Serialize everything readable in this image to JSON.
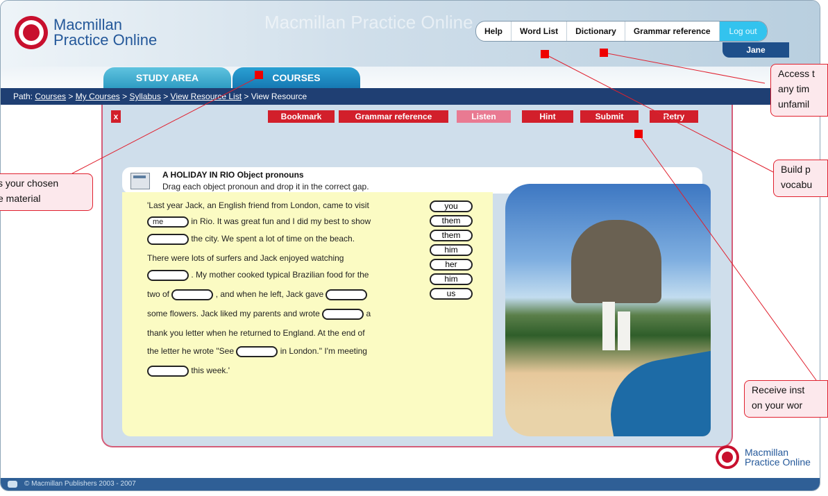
{
  "app": {
    "logo_line1": "Macmillan",
    "logo_line2": "Practice Online",
    "watermark": "Macmillan Practice Online"
  },
  "topnav": {
    "help": "Help",
    "word_list": "Word List",
    "dictionary": "Dictionary",
    "grammar_reference": "Grammar reference",
    "logout": "Log out",
    "username": "Jane"
  },
  "tabs": {
    "study_area": "STUDY AREA",
    "courses": "COURSES"
  },
  "path": {
    "label": "Path:",
    "crumbs": [
      "Courses",
      "My Courses",
      "Syllabus",
      "View Resource List"
    ],
    "current": "View Resource",
    "separator": ">"
  },
  "toolbar": {
    "close": "x",
    "bookmark": "Bookmark",
    "grammar_reference": "Grammar reference",
    "listen": "Listen",
    "hint": "Hint",
    "submit": "Submit",
    "retry": "Retry"
  },
  "exercise": {
    "title": "A HOLIDAY IN RIO   Object pronouns",
    "instruction": "Drag each object pronoun and drop it in the correct gap.",
    "lines": [
      "'Last year Jack, an English friend from London, came to visit",
      "in Rio. It was great fun and I did my best to show",
      "the city. We spent a lot of time on the beach.",
      "There were lots of surfers and Jack enjoyed watching",
      ". My mother cooked typical Brazilian food for the",
      "two of",
      ", and when he left, Jack gave",
      "some flowers. Jack liked my parents and wrote",
      "a",
      "thank you letter when he returned to England. At the end of",
      "the letter he wrote \"See",
      "in London.\" I'm meeting",
      "this week.'"
    ],
    "filled_gap": "me",
    "pronouns": [
      "you",
      "them",
      "them",
      "him",
      "her",
      "him",
      "us"
    ]
  },
  "callouts": {
    "access_tools": [
      "Access t",
      "any tim",
      "unfamil"
    ],
    "chosen_material": [
      "s your chosen",
      "e material"
    ],
    "build_vocab": [
      "Build p",
      "vocabu"
    ],
    "instant_feedback": [
      "Receive inst",
      "on your wor"
    ]
  },
  "footer": {
    "copyright": "© Macmillan Publishers 2003 - 2007"
  }
}
